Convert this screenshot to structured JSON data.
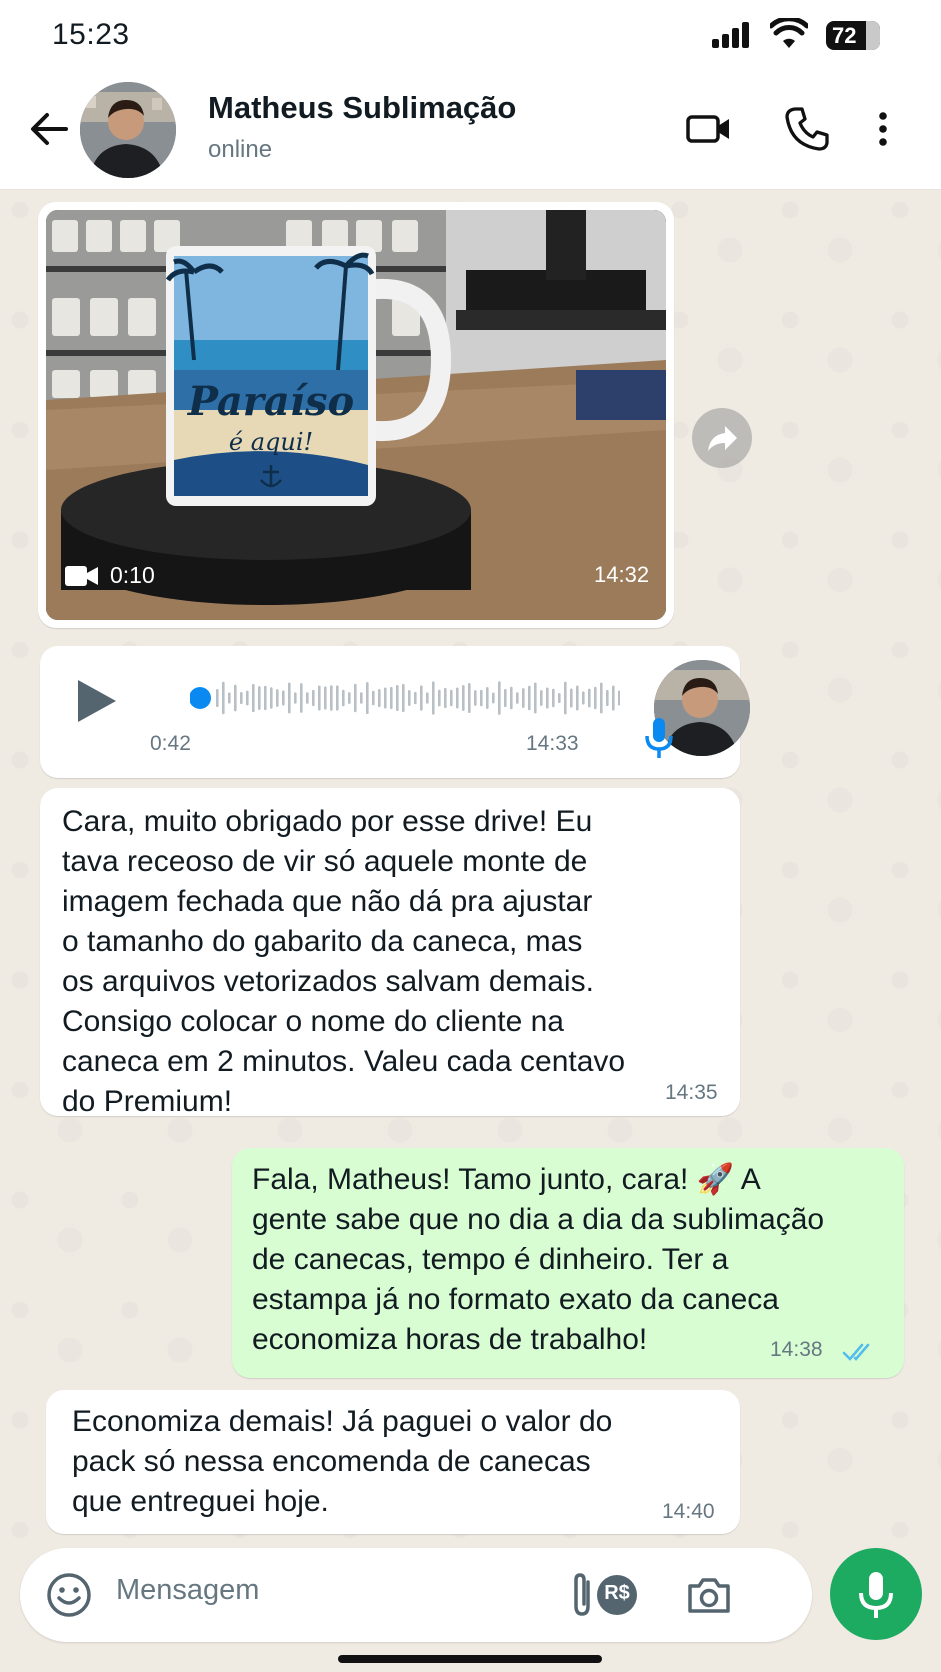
{
  "status_bar": {
    "time": "15:23",
    "battery": "72"
  },
  "header": {
    "contact_name": "Matheus Sublimação",
    "contact_status": "online"
  },
  "messages": {
    "video": {
      "mug_line1": "Paraíso",
      "mug_line2": "é aqui!",
      "duration": "0:10",
      "time": "14:32"
    },
    "audio": {
      "duration": "0:42",
      "time": "14:33"
    },
    "m1": {
      "lines": [
        "Cara, muito obrigado por esse drive! Eu",
        "tava receoso de vir só aquele monte de",
        "imagem fechada que não dá pra ajustar",
        "o tamanho do gabarito da caneca, mas",
        "os arquivos vetorizados salvam demais.",
        "Consigo colocar o nome do cliente na",
        "caneca em 2 minutos. Valeu cada centavo",
        "do Premium!"
      ],
      "time": "14:35"
    },
    "m2": {
      "lines": [
        "Fala, Matheus! Tamo junto, cara! 🚀  A",
        "gente sabe que no dia a dia da sublimação",
        "de canecas, tempo é dinheiro. Ter a",
        "estampa já no formato exato da caneca",
        "economiza horas de trabalho!"
      ],
      "time": "14:38",
      "status": "read"
    },
    "m3": {
      "lines": [
        "Economiza demais! Já paguei o valor do",
        "pack só nessa encomenda de canecas",
        "que entreguei hoje."
      ],
      "time": "14:40"
    }
  },
  "input": {
    "placeholder": "Mensagem",
    "currency_label": "R$"
  },
  "colors": {
    "chat_bg": "#efeae2",
    "outgoing_bubble": "#d9fdd3",
    "accent_green": "#1daa61",
    "read_ticks": "#53bdeb",
    "audio_dot": "#0a8af0"
  }
}
